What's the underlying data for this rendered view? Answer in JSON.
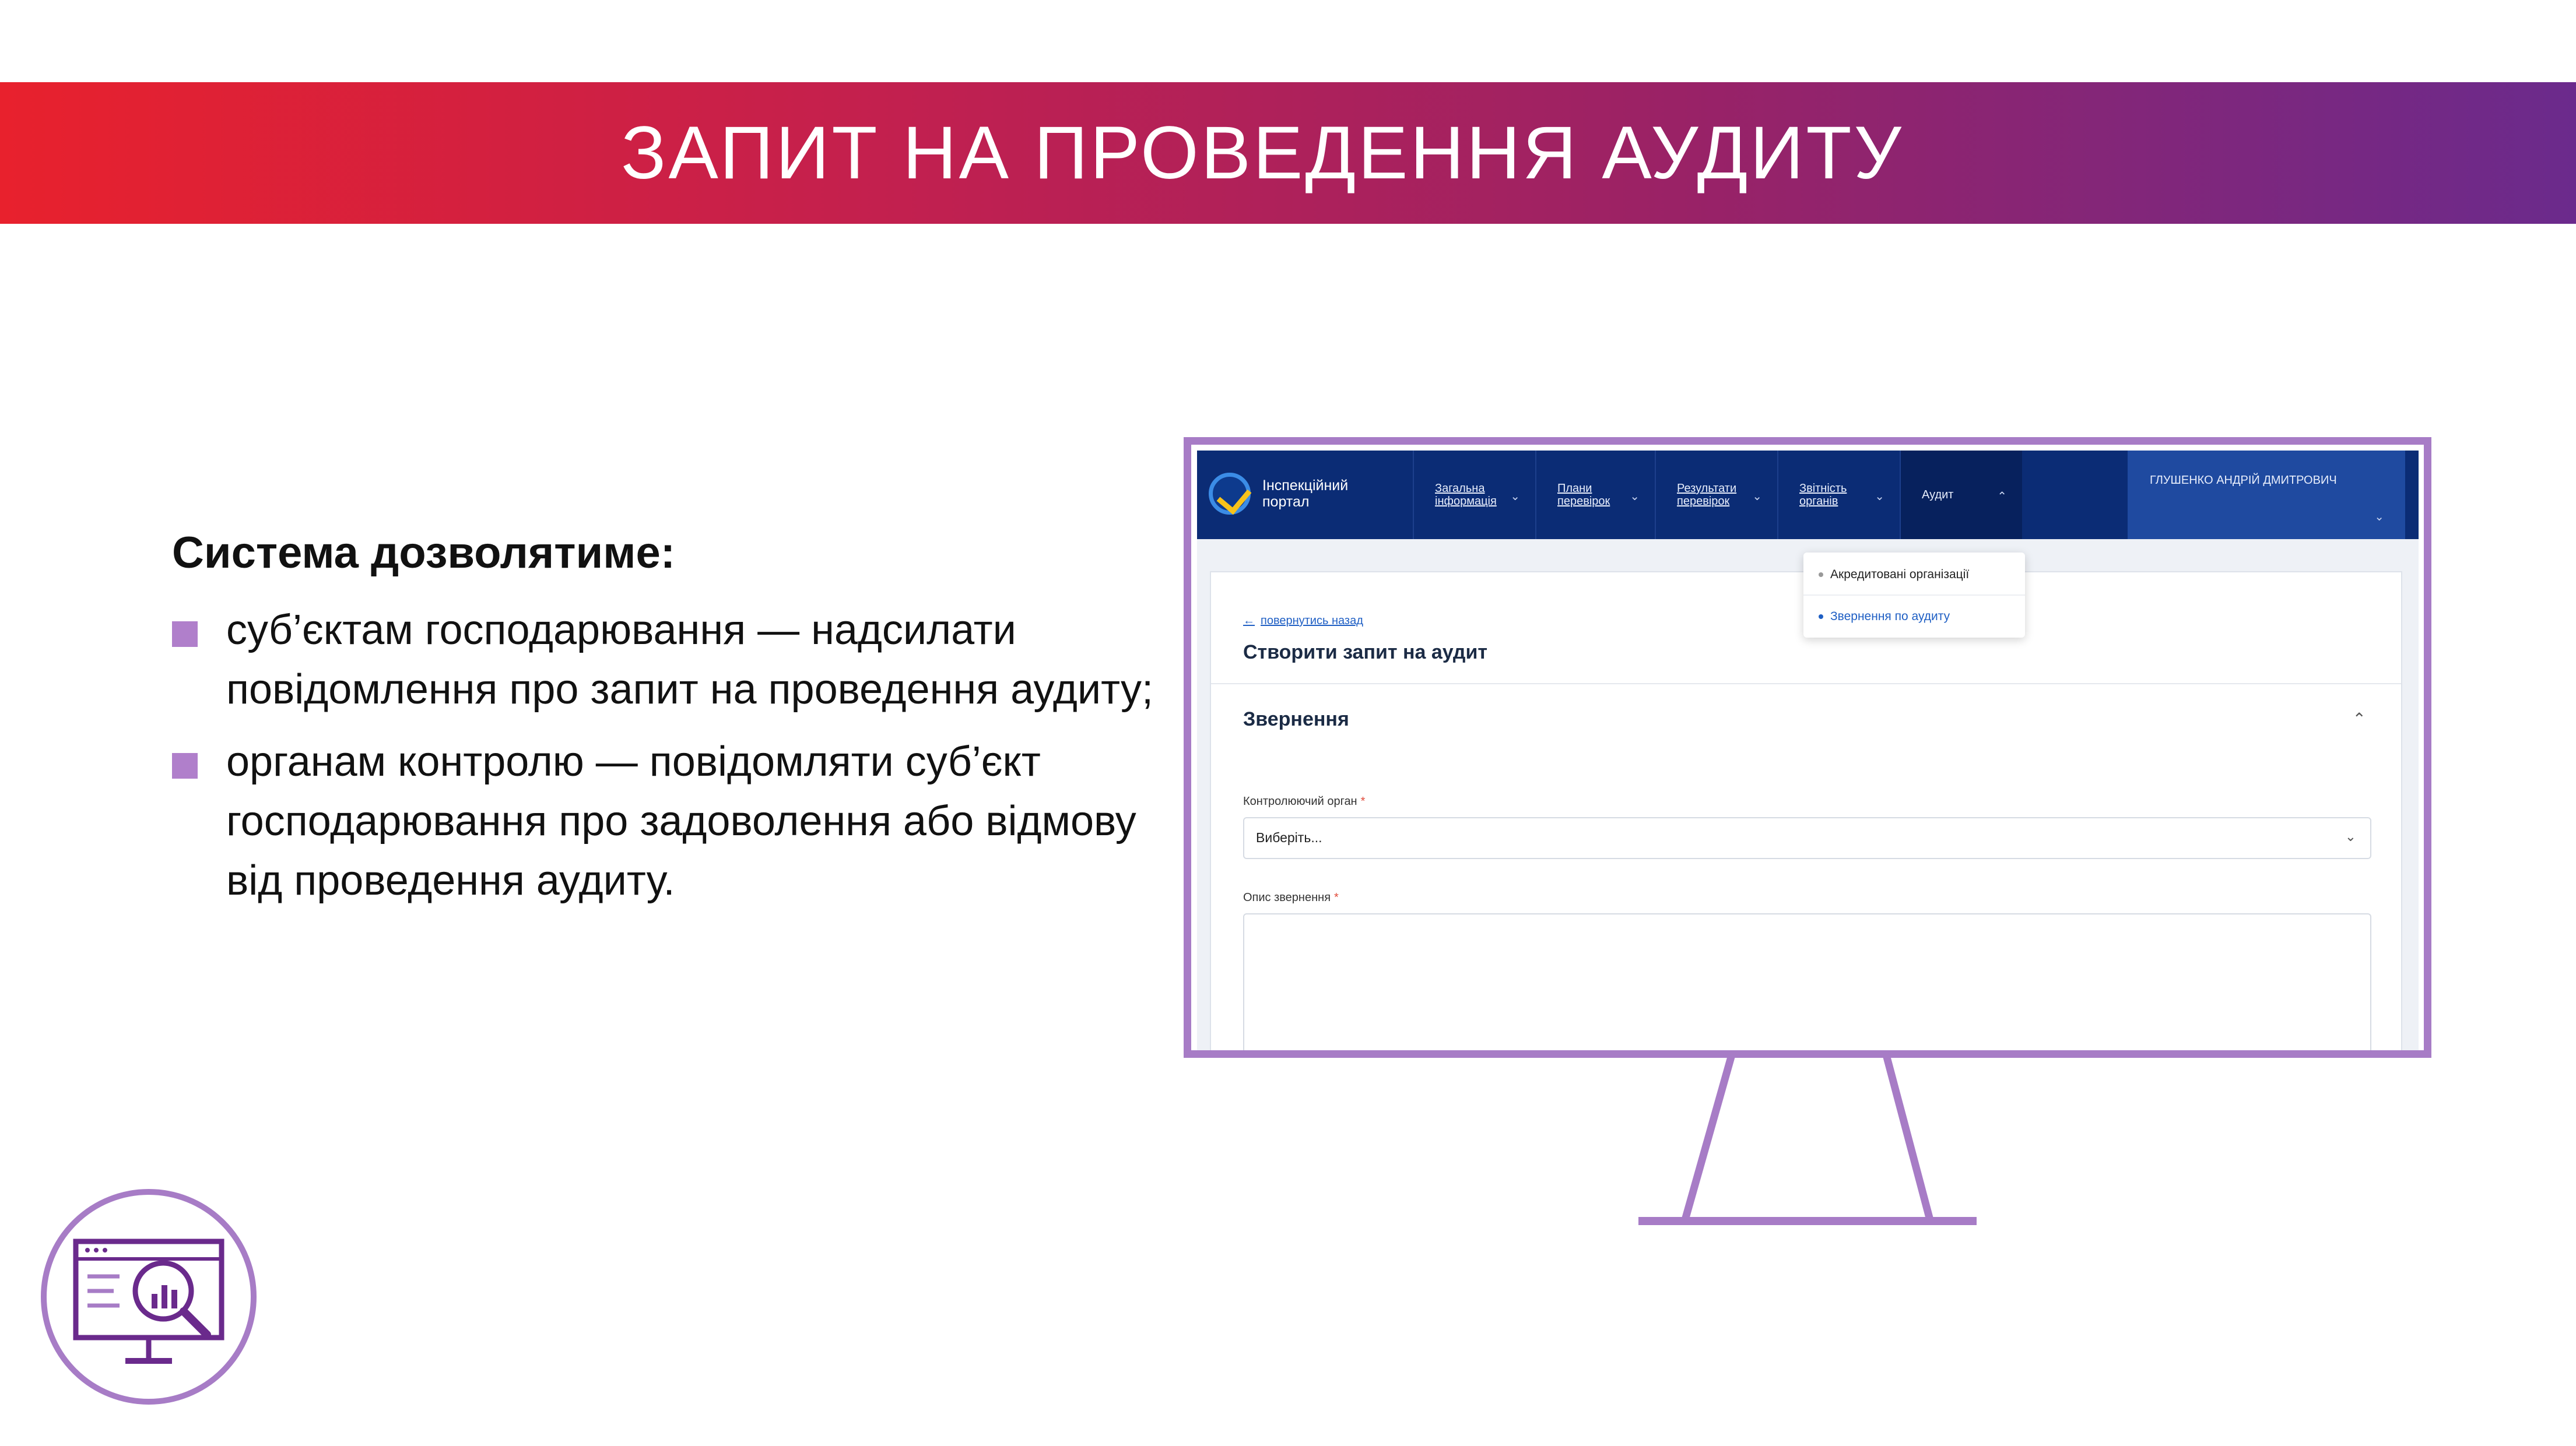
{
  "banner": {
    "title": "ЗАПИТ НА ПРОВЕДЕННЯ АУДИТУ"
  },
  "content": {
    "heading": "Система дозволятиме:",
    "bullets": [
      "суб’єктам господарювання — надсилати повідомлення про запит на проведення аудиту;",
      "органам контролю — повідомляти суб’єкт господарювання про задоволення або відмову від проведення аудиту."
    ]
  },
  "portal": {
    "logo_text_line1": "Інспекційний",
    "logo_text_line2": "портал",
    "nav": [
      {
        "line1": "Загальна",
        "line2": "інформація"
      },
      {
        "line1": "Плани",
        "line2": "перевірок"
      },
      {
        "line1": "Результати",
        "line2": "перевірок"
      },
      {
        "line1": "Звітність",
        "line2": "органів"
      },
      {
        "line1": "Аудит",
        "line2": ""
      }
    ],
    "user_name": "ГЛУШЕНКО АНДРІЙ ДМИТРОВИЧ",
    "dropdown": {
      "items": [
        "Акредитовані організації",
        "Звернення по аудиту"
      ]
    },
    "back_link": "повернутись назад",
    "page_title": "Створити запит на аудит",
    "section_title": "Звернення",
    "control_body_label": "Контролюючий орган",
    "select_value": "Виберіть...",
    "description_label": "Опис звернення",
    "required_mark": "*"
  },
  "colors": {
    "banner_start": "#e8212d",
    "banner_end": "#6b2a8c",
    "accent": "#a77cc6",
    "nav_bg": "#0b2c75",
    "link": "#1f5fc4"
  },
  "icons": {
    "corner": "monitor-analytics-magnifier-icon",
    "logo": "checkmark-circle-icon"
  }
}
